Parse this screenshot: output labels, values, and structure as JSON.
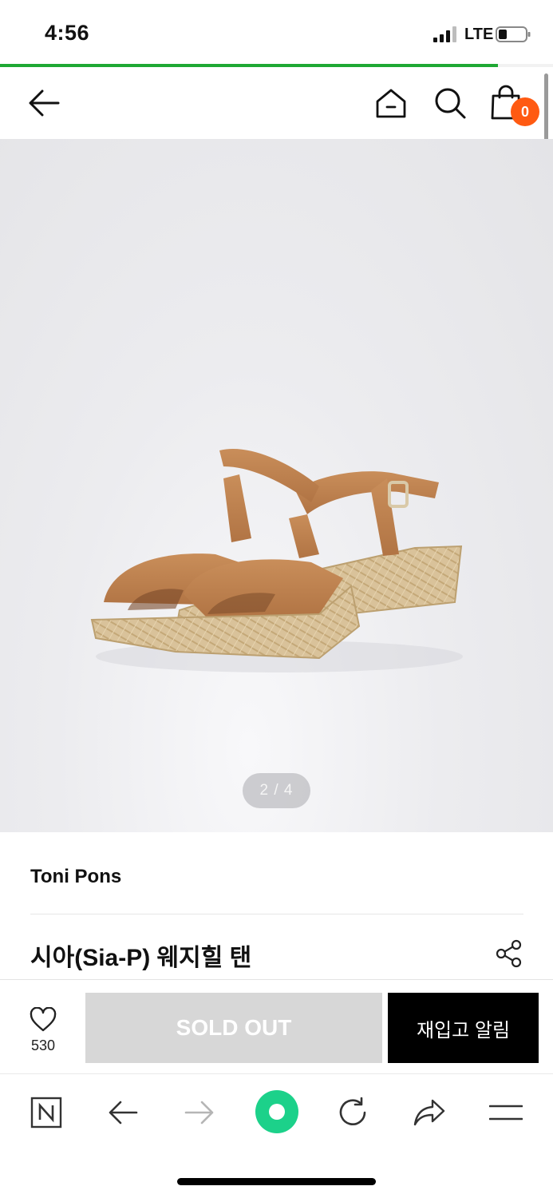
{
  "status_bar": {
    "time": "4:56",
    "carrier": "LTE"
  },
  "page_load": {
    "progress": 0.9,
    "color": "#1fa834"
  },
  "nav": {
    "cart_count": "0",
    "badge_color": "#ff5a12"
  },
  "product": {
    "image_counter": "2 / 4",
    "brand": "Toni Pons",
    "title": "시아(Sia-P) 웨지힐 탠"
  },
  "purchase": {
    "like_count": "530",
    "soldout_label": "SOLD OUT",
    "restock_label": "재입고 알림"
  },
  "browser_toolbar": {
    "icons": [
      "naver-n-icon",
      "arrow-left-icon",
      "arrow-right-icon",
      "green-dot-icon",
      "refresh-icon",
      "share-arrow-icon",
      "menu-icon"
    ],
    "accent": "#1cd18a"
  }
}
